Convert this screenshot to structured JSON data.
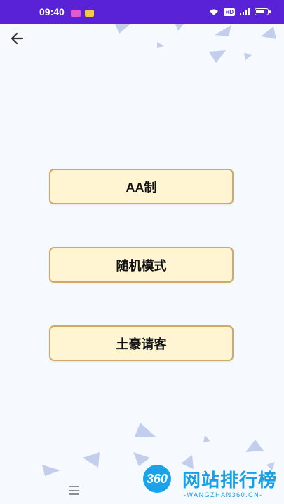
{
  "status_bar": {
    "time": "09:40",
    "hd_label": "HD",
    "battery_level": 0.8
  },
  "header": {
    "back_icon": "arrow-left-icon"
  },
  "menu": {
    "items": [
      {
        "label": "AA制"
      },
      {
        "label": "随机模式"
      },
      {
        "label": "土豪请客"
      }
    ]
  },
  "colors": {
    "status_bar": "#5a22d6",
    "background": "#f6f9fd",
    "button_fill": "#fff5d3",
    "button_border": "#cfa96b",
    "triangle": "#b9c7ea"
  },
  "nav_bar": {
    "menu_icon": "menu-lines-icon"
  },
  "watermark": {
    "logo_text": "360",
    "title": "网站排行榜",
    "url": "-WANGZHAN360.CN-"
  }
}
